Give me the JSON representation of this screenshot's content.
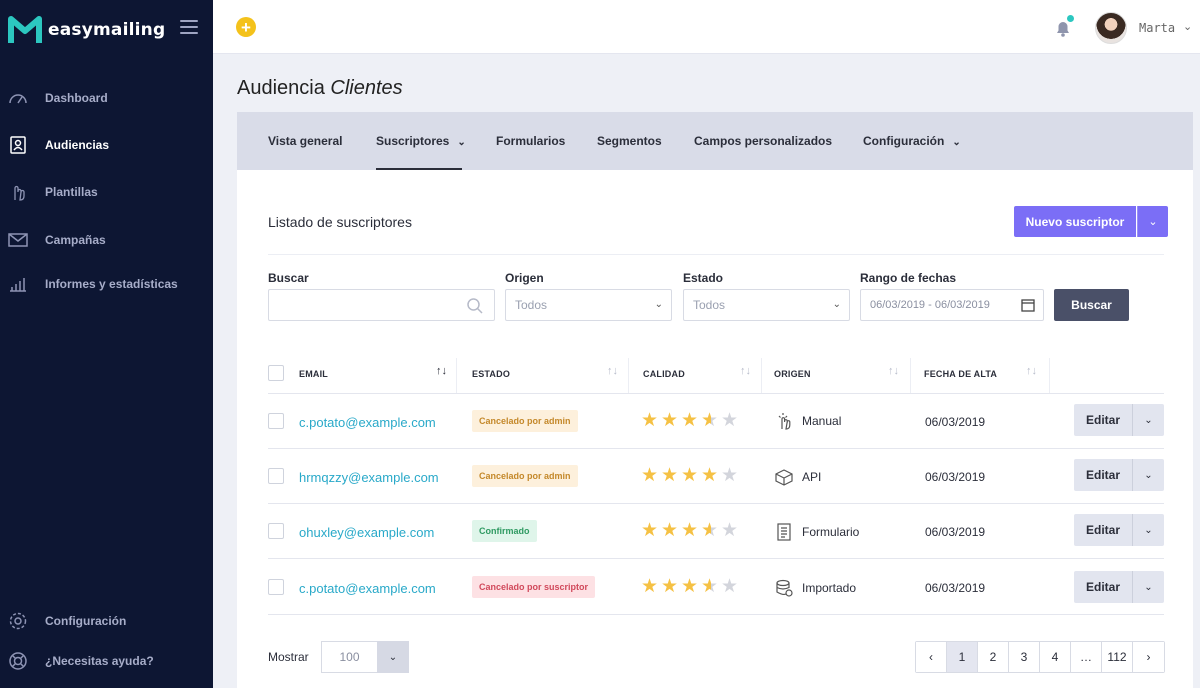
{
  "app": {
    "name": "easymailing"
  },
  "sidebar": {
    "items": [
      {
        "label": "Dashboard",
        "icon": "gauge-icon"
      },
      {
        "label": "Audiencias",
        "icon": "contacts-book-icon"
      },
      {
        "label": "Plantillas",
        "icon": "hand-pointer-icon"
      },
      {
        "label": "Campañas",
        "icon": "envelope-icon"
      },
      {
        "label": "Informes y estadísticas",
        "icon": "bar-chart-icon"
      }
    ],
    "footer": [
      {
        "label": "Configuración",
        "icon": "gear-icon"
      },
      {
        "label": "¿Necesitas ayuda?",
        "icon": "lifebuoy-icon"
      }
    ]
  },
  "topbar": {
    "add_symbol": "+",
    "user": "Marta",
    "chevron": "⌄"
  },
  "page": {
    "title_prefix": "Audiencia",
    "title_name": "Clientes"
  },
  "tabs": [
    {
      "label": "Vista general"
    },
    {
      "label": "Suscriptores",
      "caret": "⌄"
    },
    {
      "label": "Formularios"
    },
    {
      "label": "Segmentos"
    },
    {
      "label": "Campos personalizados"
    },
    {
      "label": "Configuración",
      "caret": "⌄"
    }
  ],
  "card": {
    "title": "Listado de suscriptores",
    "new_button": "Nuevo suscriptor",
    "caret": "⌄"
  },
  "filters": {
    "search_label": "Buscar",
    "origin_label": "Origen",
    "origin_value": "Todos",
    "state_label": "Estado",
    "state_value": "Todos",
    "date_label": "Rango de fechas",
    "date_value": "06/03/2019 - 06/03/2019",
    "submit": "Buscar"
  },
  "table": {
    "headers": {
      "email": "EMAIL",
      "state": "ESTADO",
      "quality": "CALIDAD",
      "origin": "ORIGEN",
      "date": "FECHA DE ALTA"
    },
    "sort_icons": {
      "active": "↑↓",
      "idle": "↑↓"
    },
    "edit_label": "Editar",
    "rows": [
      {
        "email": "c.potato@example.com",
        "state": "Cancelado por admin",
        "state_type": "warn",
        "quality": 3.5,
        "origin": "Manual",
        "origin_icon": "hand-tap-icon",
        "date": "06/03/2019"
      },
      {
        "email": "hrmqzzy@example.com",
        "state": "Cancelado por admin",
        "state_type": "warn",
        "quality": 4,
        "origin": "API",
        "origin_icon": "cube-icon",
        "date": "06/03/2019"
      },
      {
        "email": "ohuxley@example.com",
        "state": "Confirmado",
        "state_type": "ok",
        "quality": 3.5,
        "origin": "Formulario",
        "origin_icon": "form-icon",
        "date": "06/03/2019"
      },
      {
        "email": "c.potato@example.com",
        "state": "Cancelado por suscriptor",
        "state_type": "danger",
        "quality": 3.5,
        "origin": "Importado",
        "origin_icon": "database-import-icon",
        "date": "06/03/2019"
      }
    ]
  },
  "footer": {
    "show_label": "Mostrar",
    "show_value": "100",
    "pages": [
      "‹",
      "1",
      "2",
      "3",
      "4",
      "…",
      "112",
      "›"
    ],
    "active_page": "1"
  },
  "colors": {
    "accent": "#7b6ef6",
    "sidebar": "#0d1633",
    "link": "#29a9c9",
    "star": "#f5c144"
  }
}
